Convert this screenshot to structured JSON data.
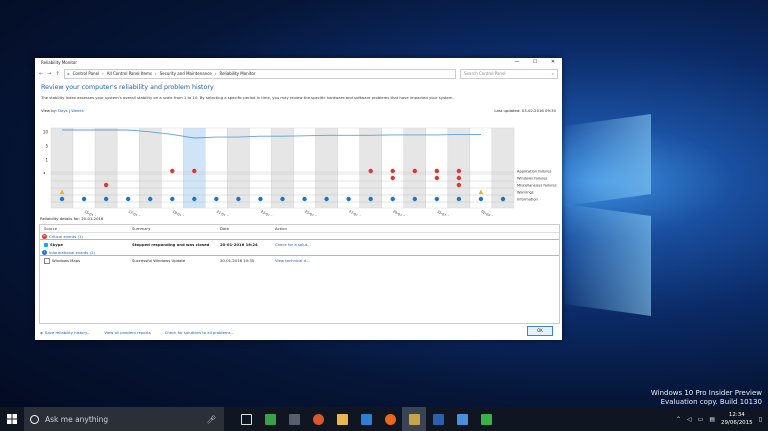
{
  "window": {
    "title": "Reliability Monitor",
    "controls": [
      "—",
      "☐",
      "✕"
    ]
  },
  "address": {
    "nav": [
      "←",
      "→",
      "↑"
    ],
    "crumbs": [
      "Control Panel",
      "All Control Panel Items",
      "Security and Maintenance",
      "Reliability Monitor"
    ],
    "search_placeholder": "Search Control Panel"
  },
  "header": {
    "title": "Review your computer's reliability and problem history",
    "description": "The stability index assesses your system's overall stability on a scale from 1 to 10. By selecting a specific period in time, you may review the specific hardware and software problems that have impacted your system.",
    "view_by_label": "View by:",
    "view_days": "Days",
    "view_weeks": "Weeks",
    "last_updated": "Last updated: 03-02-2016 09:30"
  },
  "chart_data": {
    "type": "line",
    "y_ticks": [
      "10",
      "5",
      "1"
    ],
    "x": [
      "15-01-2016",
      "17-01-2016",
      "19-01-2016",
      "21-01-2016",
      "23-01-2016",
      "25-01-2016",
      "27-01-2016",
      "29-01-2016",
      "31-01-2016",
      "02-02-2016"
    ],
    "stability_index": [
      10,
      10,
      10,
      10,
      9.6,
      9,
      8.2,
      8.4,
      8.4,
      8.6,
      8.6,
      8.7,
      8.8,
      8.8,
      8.8,
      8.9,
      8.9,
      8.9,
      9.0,
      9.0
    ],
    "row_labels": [
      "Application failures",
      "Windows failures",
      "Miscellaneous failures",
      "Warnings",
      "Information"
    ],
    "app_failure_cols": [
      5,
      6,
      14,
      15,
      16,
      17,
      18
    ],
    "windows_failure_cols": [
      15,
      17,
      18
    ],
    "misc_failure_cols": [
      2,
      18
    ],
    "warning_cols": [
      0,
      19
    ],
    "information_cols": [
      0,
      1,
      2,
      3,
      4,
      5,
      6,
      7,
      8,
      9,
      10,
      11,
      12,
      13,
      14,
      15,
      16,
      17,
      18,
      19,
      20
    ],
    "selected_col": 6
  },
  "details": {
    "title": "Reliability details for: 20-01-2016",
    "columns": [
      "Source",
      "Summary",
      "Date",
      "Action"
    ],
    "groups": [
      {
        "name": "Critical events (1)",
        "rows": [
          {
            "source": "Skype",
            "summary": "Stopped responding and was closed",
            "date": "20-01-2016 16:24",
            "action": "Check for a solut..."
          }
        ]
      },
      {
        "name": "Informational events (1)",
        "rows": [
          {
            "source": "Windows Maps",
            "summary": "Successful Windows Update",
            "date": "20-01-2016 10:35",
            "action": "View technical d..."
          }
        ]
      }
    ]
  },
  "footer": {
    "links": [
      "Save reliability history...",
      "View all problem reports",
      "Check for solutions to all problems..."
    ],
    "ok": "OK"
  },
  "taskbar": {
    "search_placeholder": "Ask me anything",
    "time": "12:34",
    "date": "29/06/2015"
  },
  "watermark": {
    "line1": "Windows 10 Pro Insider Preview",
    "line2": "Evaluation copy. Build 10130"
  },
  "colors": {
    "accent": "#1a5fb4",
    "error": "#e0342c",
    "warning": "#f0b400",
    "info": "#1e74c8",
    "line": "#5aa3e0"
  }
}
